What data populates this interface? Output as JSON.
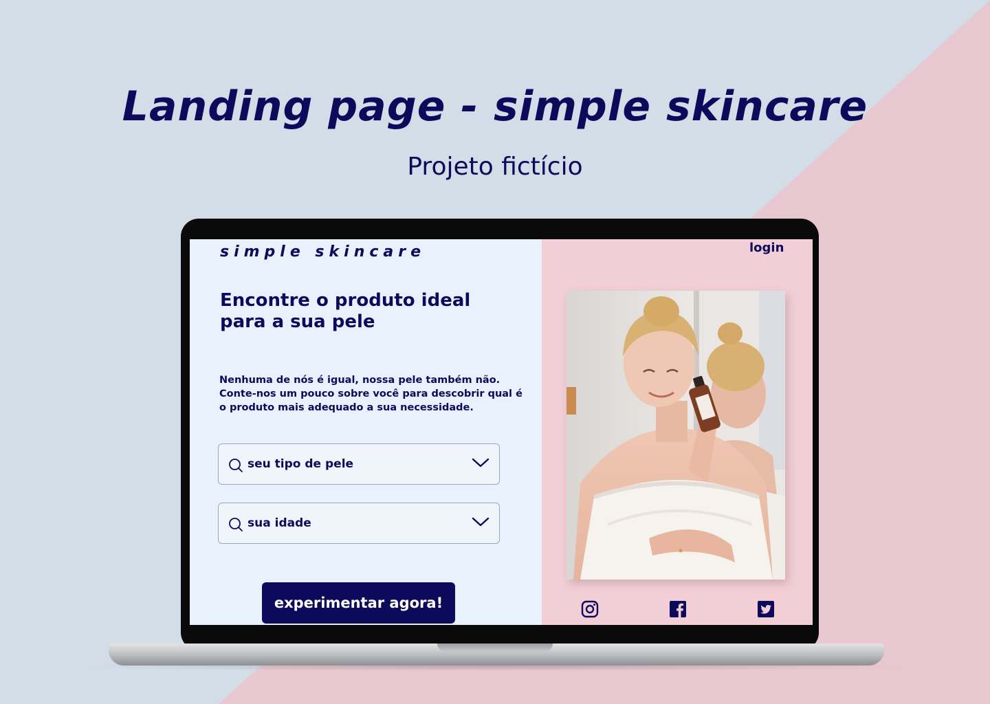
{
  "slide": {
    "title": "Landing page - simple skincare",
    "subtitle": "Projeto fictício"
  },
  "colors": {
    "background_blue": "#d2dde8",
    "background_pink": "#e8c8d0",
    "navy": "#0d0a5c",
    "screen_left": "#e8f1fc",
    "screen_right": "#f2cfd6"
  },
  "site": {
    "brand": "simple skincare",
    "login_label": "login",
    "hero_title": "Encontre o produto ideal para a sua pele",
    "hero_description": "Nenhuma de nós é igual, nossa pele também não. Conte-nos um pouco sobre você para descobrir qual é o produto mais adequado a sua necessidade.",
    "skin_type_select": {
      "label": "seu tipo de pele",
      "icon": "search-icon"
    },
    "age_select": {
      "label": "sua idade",
      "icon": "search-icon"
    },
    "cta_label": "experimentar agora!",
    "social_icons": [
      "instagram-icon",
      "facebook-icon",
      "twitter-icon"
    ]
  }
}
